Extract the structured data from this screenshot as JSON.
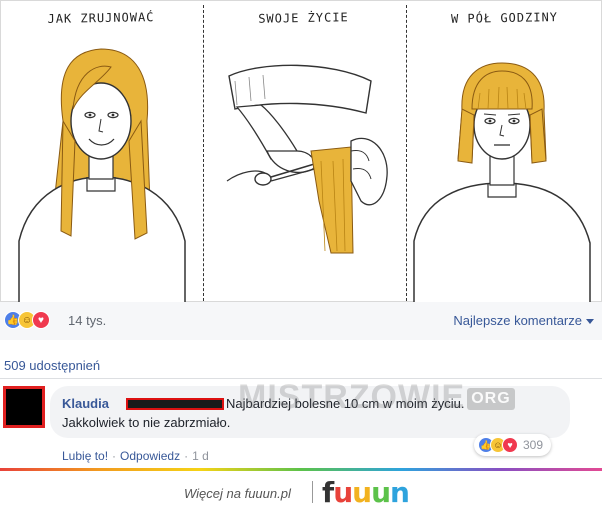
{
  "comic": {
    "panels": [
      {
        "caption": "JAK ZRUJNOWAĆ"
      },
      {
        "caption": "SWOJE ŻYCIE"
      },
      {
        "caption": "W PÓŁ GODZINY"
      }
    ]
  },
  "reactions": {
    "icons": [
      "like-icon",
      "haha-icon",
      "love-icon"
    ],
    "count": "14 tys.",
    "sort_label": "Najlepsze komentarze"
  },
  "shares": {
    "label": "509 udostępnień"
  },
  "comment": {
    "author": "Klaudia",
    "text_line1": "Najbardziej bolesne 10 cm w moim życiu.",
    "text_line2": "Jakkolwiek to nie zabrzmiało.",
    "reaction_count": "309",
    "like_action": "Lubię to!",
    "reply_action": "Odpowiedz",
    "time": "1 d"
  },
  "watermark": {
    "text": "MISTRZOWIE",
    "suffix": "ORG"
  },
  "footer": {
    "text": "Więcej na fuuun.pl",
    "logo_letters": [
      "f",
      "u",
      "u",
      "u",
      "n"
    ],
    "logo_colors": [
      "#333333",
      "#e8423a",
      "#f2b21f",
      "#5cc24a",
      "#2ea3dd"
    ]
  },
  "colors": {
    "link": "#385898",
    "like": "#4e7fe8",
    "love": "#f0394f",
    "haha": "#f7c537",
    "hair": "#e8b43a"
  }
}
